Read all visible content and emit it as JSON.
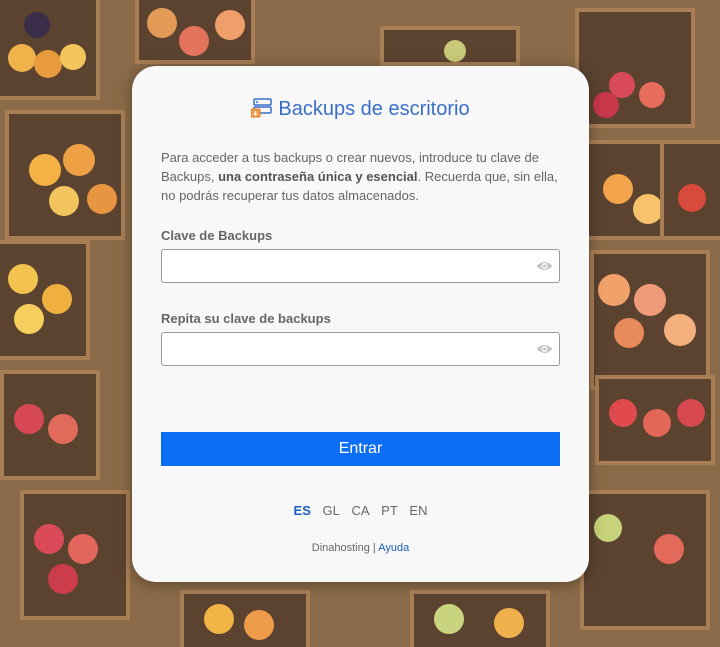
{
  "app": {
    "title": "Backups de escritorio",
    "accent_color": "#0b6ef5"
  },
  "intro": {
    "part1": "Para acceder a tus backups o crear nuevos, introduce tu clave de Backups, ",
    "bold": "una contraseña única y esencial",
    "part2": ". Recuerda que, sin ella, no podrás recuperar tus datos almacenados."
  },
  "fields": {
    "password": {
      "label": "Clave de Backups",
      "value": "",
      "icon": "eye-icon"
    },
    "repeat": {
      "label": "Repita su clave de backups",
      "value": "",
      "icon": "eye-icon"
    }
  },
  "submit_label": "Entrar",
  "languages": [
    {
      "code": "ES",
      "active": true
    },
    {
      "code": "GL",
      "active": false
    },
    {
      "code": "CA",
      "active": false
    },
    {
      "code": "PT",
      "active": false
    },
    {
      "code": "EN",
      "active": false
    }
  ],
  "footer": {
    "brand": "Dinahosting",
    "separator": " | ",
    "help_link": "Ayuda"
  }
}
